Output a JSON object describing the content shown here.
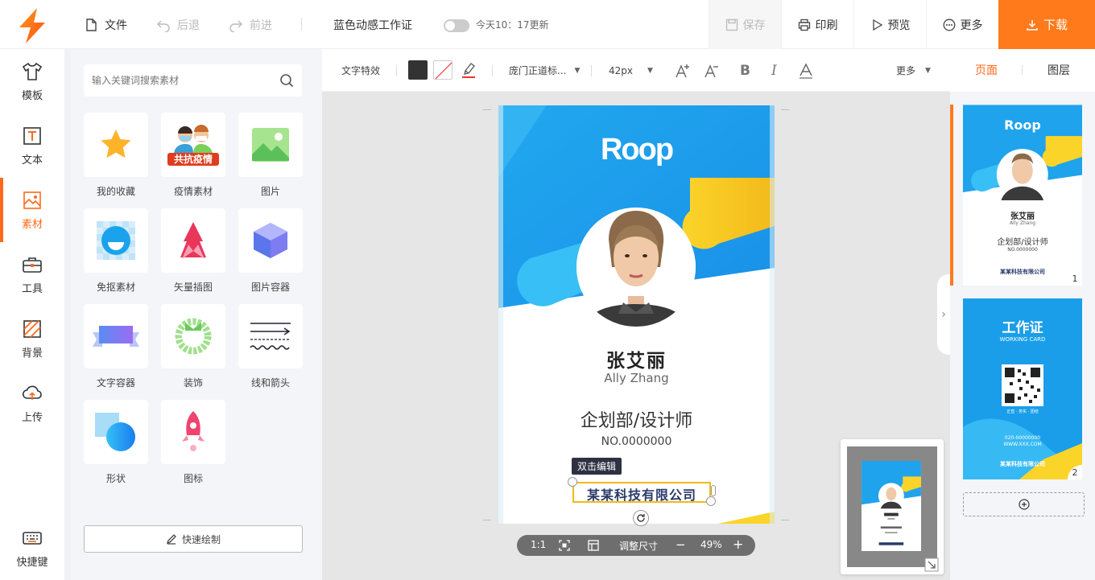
{
  "topbar": {
    "file_label": "文件",
    "undo_label": "后退",
    "redo_label": "前进",
    "doc_title": "蓝色动感工作证",
    "save_time": "今天10：17更新",
    "save_label": "保存",
    "print_label": "印刷",
    "preview_label": "预览",
    "more_label": "更多",
    "download_label": "下载",
    "accent_color": "#ff7a1a"
  },
  "leftnav": {
    "items": [
      {
        "label": "模板",
        "icon": "shirt-icon"
      },
      {
        "label": "文本",
        "icon": "text-icon"
      },
      {
        "label": "素材",
        "icon": "image-icon"
      },
      {
        "label": "工具",
        "icon": "toolbox-icon"
      },
      {
        "label": "背景",
        "icon": "background-icon"
      },
      {
        "label": "上传",
        "icon": "upload-icon"
      },
      {
        "label": "快捷键",
        "icon": "keyboard-icon"
      }
    ]
  },
  "material": {
    "search_placeholder": "输入关键词搜索素材",
    "tiles": [
      {
        "label": "我的收藏",
        "icon": "star-icon"
      },
      {
        "label": "疫情素材",
        "icon": "epidemic-icon"
      },
      {
        "label": "图片",
        "icon": "picture-icon"
      },
      {
        "label": "免抠素材",
        "icon": "cutout-icon"
      },
      {
        "label": "矢量插图",
        "icon": "vector-tree-icon"
      },
      {
        "label": "图片容器",
        "icon": "cube-icon"
      },
      {
        "label": "文字容器",
        "icon": "ribbon-icon"
      },
      {
        "label": "装饰",
        "icon": "wreath-icon"
      },
      {
        "label": "线和箭头",
        "icon": "lines-arrows-icon"
      },
      {
        "label": "形状",
        "icon": "shapes-icon"
      },
      {
        "label": "图标",
        "icon": "rocket-icon"
      }
    ],
    "epidemic_badge": "共抗疫情",
    "quick_draw_label": "快速绘制"
  },
  "edit_toolbar": {
    "text_effect_label": "文字特效",
    "font_name": "庞门正道标...",
    "font_size": "42px",
    "more_label": "更多",
    "text_color": "#333333"
  },
  "card": {
    "logo_text": "Roop",
    "name": "张艾丽",
    "name_en": "Ally Zhang",
    "title": "企划部/设计师",
    "number": "NO.0000000",
    "company": "某某科技有限公司",
    "primary_color": "#1aa3ec",
    "accent_yellow": "#f7c61a"
  },
  "canvas": {
    "edit_tip": "双击编辑",
    "zoom_ratio_label": "1:1",
    "resize_label": "调整尺寸",
    "zoom_level": "49%",
    "zoom_minus": "−",
    "zoom_plus": "+"
  },
  "rpanel": {
    "tab_page": "页面",
    "tab_layer": "图层",
    "page1": {
      "logo": "Roop",
      "name": "张艾丽",
      "name_en": "Ally Zhang",
      "title": "企划部/设计师",
      "number": "NO.0000000",
      "company": "某某科技有限公司",
      "num": "1"
    },
    "page2": {
      "title": "工作证",
      "subtitle": "WORKING CARD",
      "tagline": "正直 · 务实 · 团结",
      "phone": "020-00000000",
      "website": "WWW.XXX.COM",
      "company": "某某科技有限公司",
      "num": "2"
    },
    "add_icon": "plus-circle-icon"
  }
}
